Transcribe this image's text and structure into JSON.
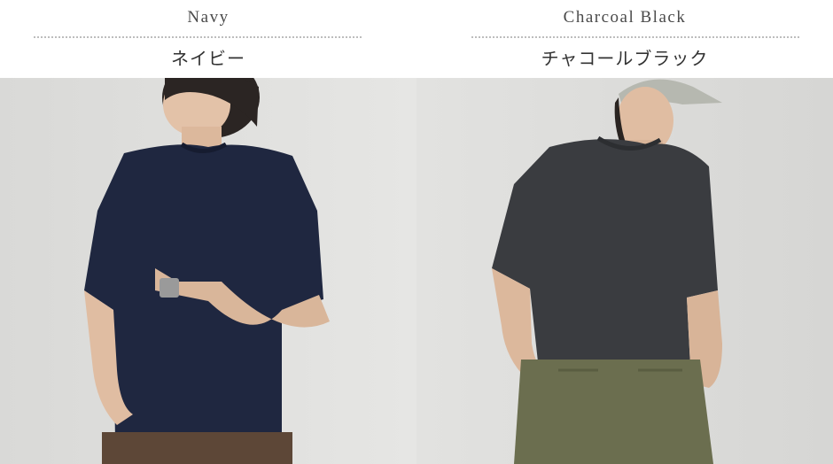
{
  "products": [
    {
      "color_en": "Navy",
      "color_jp": "ネイビー",
      "swatch": "#1f2740",
      "photo_icon": "model-wearing-tshirt"
    },
    {
      "color_en": "Charcoal Black",
      "color_jp": "チャコールブラック",
      "swatch": "#3a3c40",
      "photo_icon": "model-wearing-tshirt"
    }
  ]
}
